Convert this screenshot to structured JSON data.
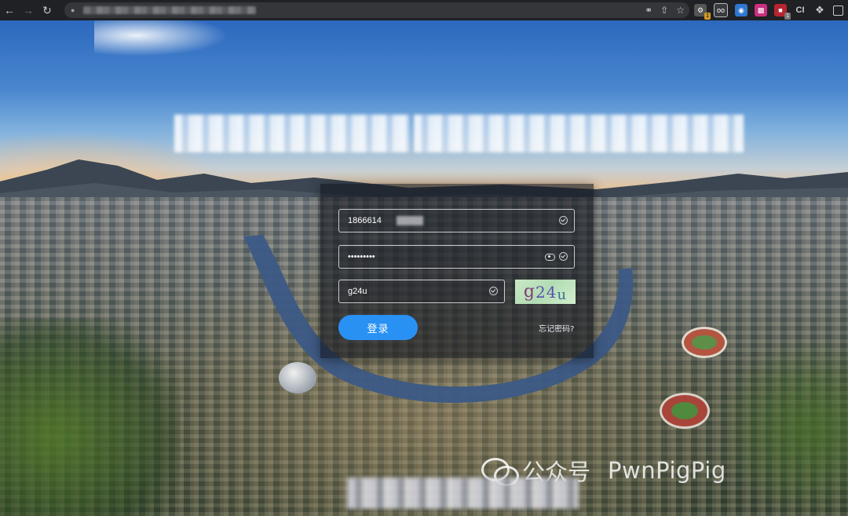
{
  "browser": {
    "back_icon": "arrow-left-icon",
    "forward_icon": "arrow-right-icon",
    "reload_icon": "reload-icon",
    "extension_badge_1": "1",
    "extension_badge_2": "1",
    "extension_label_ci": "CI"
  },
  "login": {
    "username_value": "1866614",
    "password_value": "•••••••••",
    "captcha_input_value": "g24u",
    "captcha_image": {
      "c1": "g",
      "c2": "24",
      "c3": "u"
    },
    "login_button_label": "登录",
    "forgot_password_label": "忘记密码?"
  },
  "watermark": {
    "text": "公众号",
    "name": "PwnPigPig"
  }
}
